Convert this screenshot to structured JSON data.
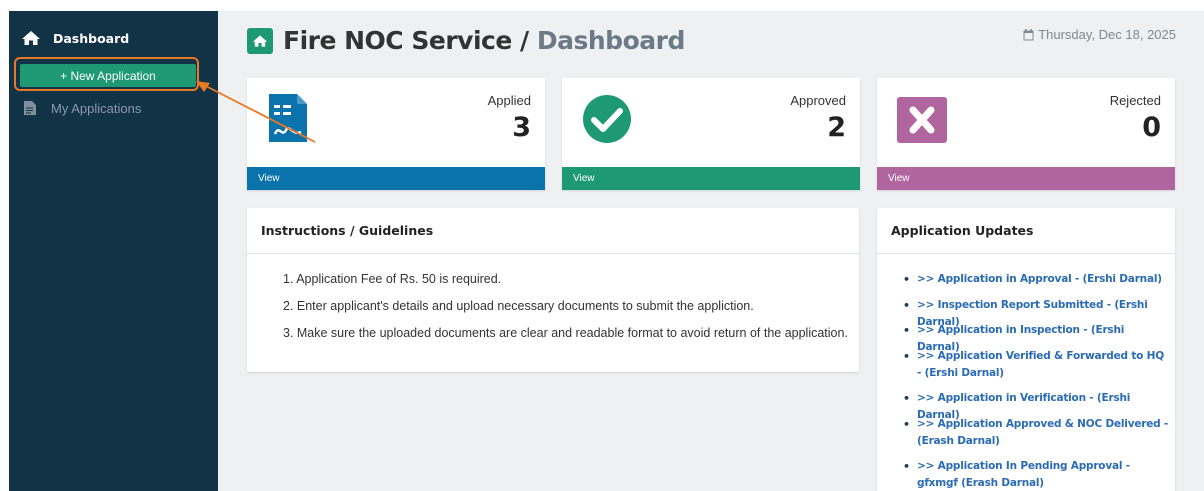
{
  "sidebar": {
    "dashboard_label": "Dashboard",
    "new_application_label": "+ New Application",
    "my_applications_label": "My Applications"
  },
  "header": {
    "title": "Fire NOC Service",
    "separator": "/",
    "subtitle": "Dashboard",
    "date": "Thursday, Dec 18, 2025"
  },
  "cards": [
    {
      "label": "Applied",
      "value": "3",
      "link": "View",
      "color": "#0a73ab"
    },
    {
      "label": "Approved",
      "value": "2",
      "link": "View",
      "color": "#1e9a72"
    },
    {
      "label": "Rejected",
      "value": "0",
      "link": "View",
      "color": "#b0659e"
    }
  ],
  "instructions": {
    "title": "Instructions / Guidelines",
    "items": [
      "1. Application Fee of Rs. 50 is required.",
      "2. Enter applicant's details and upload necessary documents to submit the appliction.",
      "3. Make sure the uploaded documents are clear and readable format to avoid return of the application."
    ]
  },
  "updates": {
    "title": "Application Updates",
    "items": [
      ">> Application in Approval - (Ershi Darnal)",
      ">> Inspection Report Submitted - (Ershi Darnal)",
      ">> Application in Inspection - (Ershi Darnal)",
      ">> Application Verified & Forwarded to HQ - (Ershi Darnal)",
      ">> Application in Verification - (Ershi Darnal)",
      ">> Application Approved & NOC Delivered - (Erash Darnal)",
      ">> Application In Pending Approval - gfxmgf (Erash Darnal)"
    ]
  },
  "colors": {
    "sidebar_bg": "#123246",
    "accent_green": "#1e9a72",
    "highlight_orange": "#e87926",
    "link_blue": "#2a6bb5"
  }
}
